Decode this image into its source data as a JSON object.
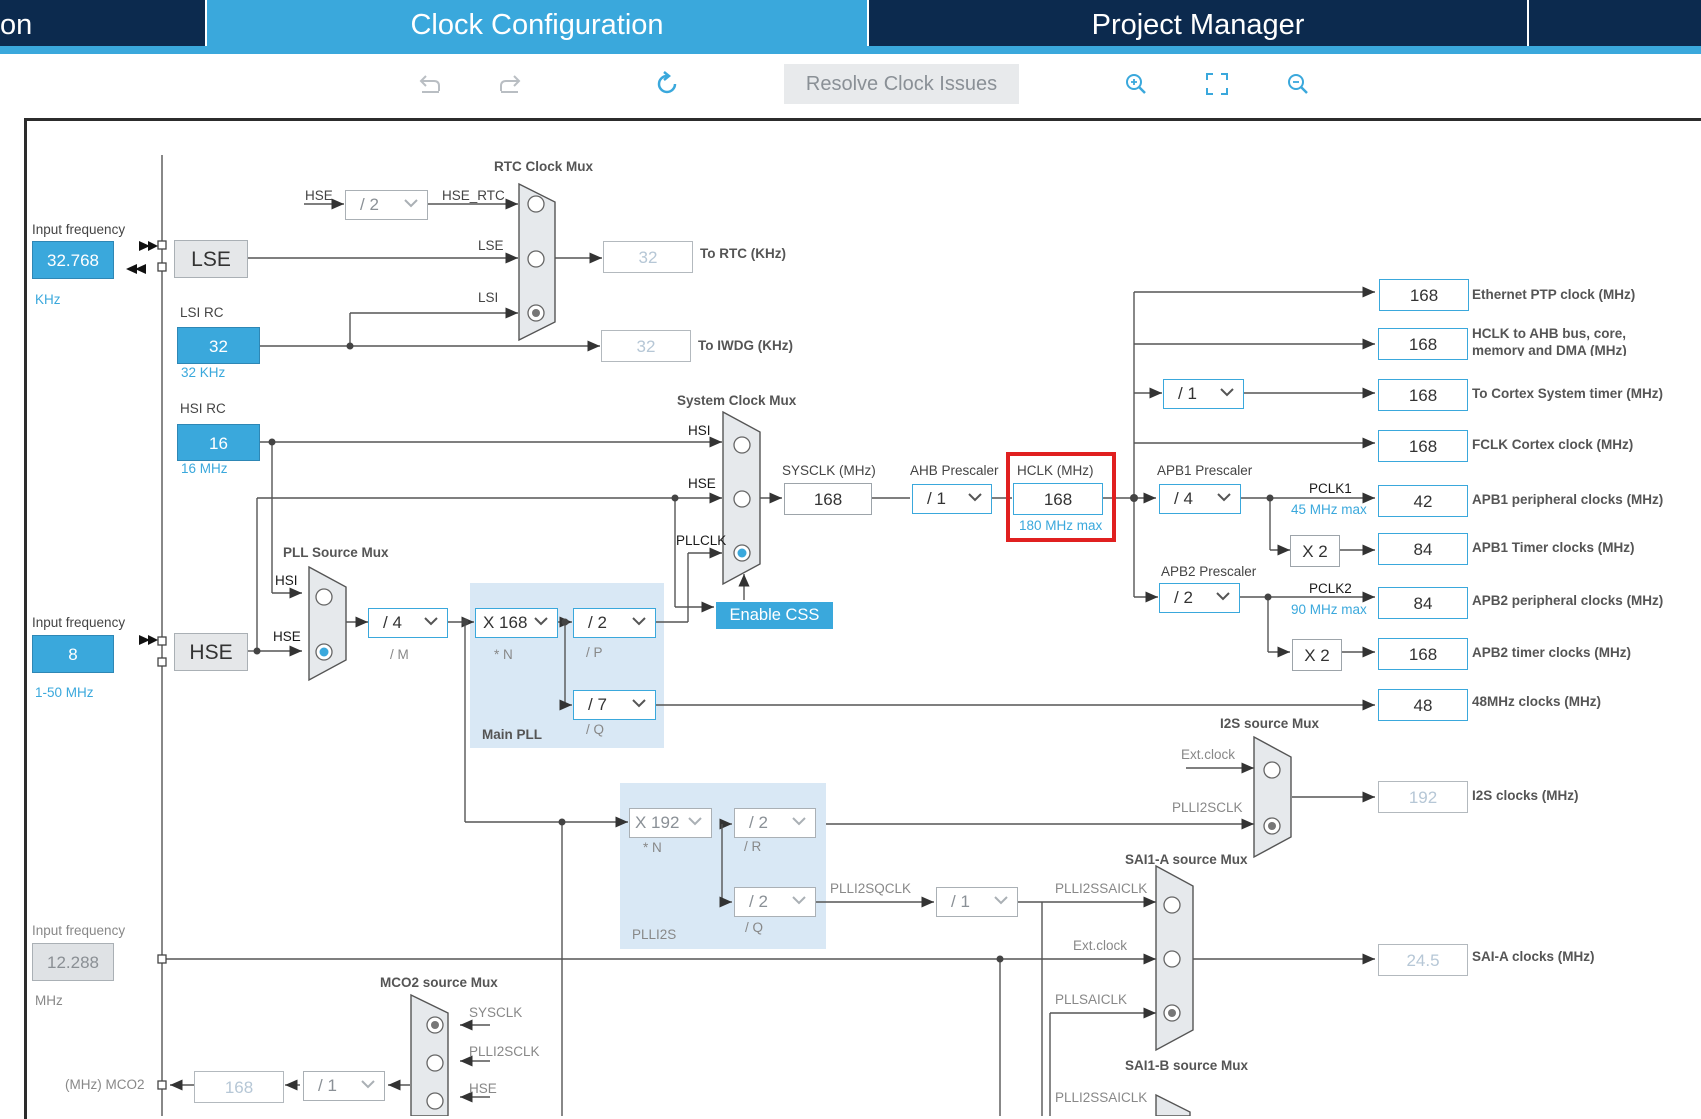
{
  "tabs": [
    {
      "label": "on"
    },
    {
      "label": "Clock Configuration"
    },
    {
      "label": "Project Manager"
    }
  ],
  "toolbar": {
    "undo_icon": "undo-icon",
    "redo_icon": "redo-icon",
    "refresh_icon": "refresh-icon",
    "resolve_label": "Resolve Clock Issues",
    "zoom_in_icon": "zoom-in-icon",
    "fit_icon": "fit-icon",
    "zoom_out_icon": "zoom-out-icon"
  },
  "inputs": {
    "lse": {
      "caption": "Input frequency",
      "value": "32.768",
      "unit": "KHz",
      "name": "LSE"
    },
    "lsi": {
      "caption": "LSI RC",
      "value": "32",
      "unit": "32 KHz"
    },
    "hsi": {
      "caption": "HSI RC",
      "value": "16",
      "unit": "16 MHz"
    },
    "hse": {
      "caption": "Input frequency",
      "value": "8",
      "unit": "1-50 MHz",
      "name": "HSE"
    },
    "ext": {
      "caption": "Input frequency",
      "value": "12.288",
      "unit": "MHz"
    }
  },
  "rtc": {
    "title": "RTC Clock Mux",
    "hse_label": "HSE",
    "div": "/ 2",
    "hse_rtc": "HSE_RTC",
    "lse": "LSE",
    "lsi": "LSI",
    "out_value": "32",
    "out_label": "To RTC (KHz)",
    "iwdg_value": "32",
    "iwdg_label": "To IWDG (KHz)"
  },
  "sysmux": {
    "title": "System Clock Mux",
    "hsi": "HSI",
    "hse": "HSE",
    "pllclk": "PLLCLK",
    "enable_css": "Enable CSS"
  },
  "pllsrc": {
    "title": "PLL Source Mux",
    "hsi": "HSI",
    "hse": "HSE"
  },
  "mainpll": {
    "title": "Main PLL",
    "m": "/ 4",
    "m_lbl": "/ M",
    "n": "X 168",
    "n_lbl": "* N",
    "p": "/ 2",
    "p_lbl": "/ P",
    "q": "/ 7",
    "q_lbl": "/ Q"
  },
  "sys": {
    "sysclk_label": "SYSCLK (MHz)",
    "sysclk": "168",
    "ahb_label": "AHB Prescaler",
    "ahb": "/ 1",
    "hclk_label": "HCLK (MHz)",
    "hclk": "168",
    "hclk_max": "180 MHz max",
    "cortex_div": "/ 1",
    "apb1_label": "APB1 Prescaler",
    "apb1": "/ 4",
    "pclk1": "PCLK1",
    "pclk1_max": "45 MHz max",
    "apb2_label": "APB2 Prescaler",
    "apb2": "/ 2",
    "pclk2": "PCLK2",
    "pclk2_max": "90 MHz max",
    "x2a": "X 2",
    "x2b": "X 2"
  },
  "outputs": [
    {
      "value": "168",
      "label": "Ethernet PTP clock (MHz)"
    },
    {
      "value": "168",
      "label": "HCLK to AHB bus, core,",
      "label2": "memory and DMA (MHz)"
    },
    {
      "value": "168",
      "label": "To Cortex System timer (MHz)"
    },
    {
      "value": "168",
      "label": "FCLK Cortex clock (MHz)"
    },
    {
      "value": "42",
      "label": "APB1 peripheral clocks (MHz)"
    },
    {
      "value": "84",
      "label": "APB1 Timer clocks (MHz)"
    },
    {
      "value": "84",
      "label": "APB2 peripheral clocks (MHz)"
    },
    {
      "value": "168",
      "label": "APB2 timer clocks (MHz)"
    },
    {
      "value": "48",
      "label": "48MHz clocks (MHz)"
    }
  ],
  "i2s": {
    "title": "I2S source Mux",
    "ext": "Ext.clock",
    "plli2sclk": "PLLI2SCLK",
    "value": "192",
    "label": "I2S clocks (MHz)"
  },
  "plli2s": {
    "title": "PLLI2S",
    "n": "X 192",
    "n_lbl": "* N",
    "r": "/ 2",
    "r_lbl": "/ R",
    "q": "/ 2",
    "q_lbl": "/ Q",
    "qclk": "PLLI2SQCLK",
    "div": "/ 1"
  },
  "saia": {
    "title": "SAI1-A source Mux",
    "plli2ssaiclk": "PLLI2SSAICLK",
    "ext": "Ext.clock",
    "pllsaiclk": "PLLSAICLK",
    "value": "24.5",
    "label": "SAI-A clocks (MHz)"
  },
  "saib": {
    "title": "SAI1-B source Mux",
    "plli2ssaiclk": "PLLI2SSAICLK"
  },
  "mco2": {
    "title": "MCO2 source Mux",
    "sysclk": "SYSCLK",
    "plli2sclk": "PLLI2SCLK",
    "hse": "HSE",
    "label": "(MHz) MCO2",
    "value": "168",
    "div": "/ 1"
  }
}
